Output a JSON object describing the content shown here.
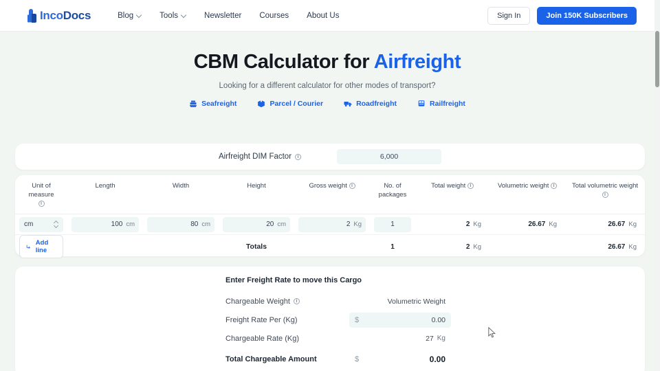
{
  "brand": {
    "part1": "Inco",
    "part2": "Docs",
    "logo_icon": "incodocs-logo-icon"
  },
  "nav": {
    "items": [
      {
        "label": "Blog",
        "has_dropdown": true
      },
      {
        "label": "Tools",
        "has_dropdown": true
      },
      {
        "label": "Newsletter",
        "has_dropdown": false
      },
      {
        "label": "Courses",
        "has_dropdown": false
      },
      {
        "label": "About Us",
        "has_dropdown": false
      }
    ],
    "sign_in": "Sign In",
    "subscribe": "Join 150K Subscribers",
    "accent_color": "#1a63e8"
  },
  "hero": {
    "title_main": "CBM Calculator for ",
    "title_accent": "Airfreight",
    "subtitle": "Looking for a different calculator for other modes of transport?",
    "modes": [
      {
        "label": "Seafreight",
        "icon": "ship-icon"
      },
      {
        "label": "Parcel / Courier",
        "icon": "parcel-icon"
      },
      {
        "label": "Roadfreight",
        "icon": "truck-icon"
      },
      {
        "label": "Railfreight",
        "icon": "train-icon"
      }
    ]
  },
  "dim_factor": {
    "label": "Airfreight DIM Factor",
    "info_icon": "info-icon",
    "value": "6,000"
  },
  "table": {
    "columns": [
      {
        "label": "Unit of measure",
        "info": true
      },
      {
        "label": "Length",
        "info": false
      },
      {
        "label": "Width",
        "info": false
      },
      {
        "label": "Height",
        "info": false
      },
      {
        "label": "Gross weight",
        "info": true
      },
      {
        "label": "No. of packages",
        "info": false
      },
      {
        "label": "Total weight",
        "info": true
      },
      {
        "label": "Volumetric weight",
        "info": true
      },
      {
        "label": "Total volumetric weight",
        "info": true
      }
    ],
    "rows": [
      {
        "unit": "cm",
        "length": "100",
        "length_unit": "cm",
        "width": "80",
        "width_unit": "cm",
        "height": "20",
        "height_unit": "cm",
        "gross_weight": "2",
        "gross_weight_unit": "Kg",
        "packages": "1",
        "total_weight": "2",
        "total_weight_unit": "Kg",
        "volumetric_weight": "26.67",
        "volumetric_weight_unit": "Kg",
        "total_volumetric_weight": "26.67",
        "total_volumetric_weight_unit": "Kg"
      }
    ],
    "add_line": "Add line",
    "add_line_icon": "arrow-turn-down-right-icon",
    "totals": {
      "label": "Totals",
      "packages": "1",
      "total_weight": "2",
      "total_weight_unit": "Kg",
      "total_volumetric_weight": "26.67",
      "total_volumetric_weight_unit": "Kg"
    }
  },
  "freight_rate": {
    "title": "Enter Freight Rate to move this Cargo",
    "rows": [
      {
        "label": "Chargeable Weight",
        "info": true,
        "value": "Volumetric Weight",
        "field": false,
        "dollar": false,
        "unit": ""
      },
      {
        "label": "Freight Rate Per (Kg)",
        "info": false,
        "value": "0.00",
        "field": true,
        "dollar": true,
        "unit": ""
      },
      {
        "label": "Chargeable Rate (Kg)",
        "info": false,
        "value": "27",
        "field": false,
        "dollar": false,
        "unit": "Kg"
      },
      {
        "label": "Total Chargeable Amount",
        "info": false,
        "value": "0.00",
        "field": false,
        "dollar": true,
        "unit": "",
        "bold": true
      }
    ]
  }
}
